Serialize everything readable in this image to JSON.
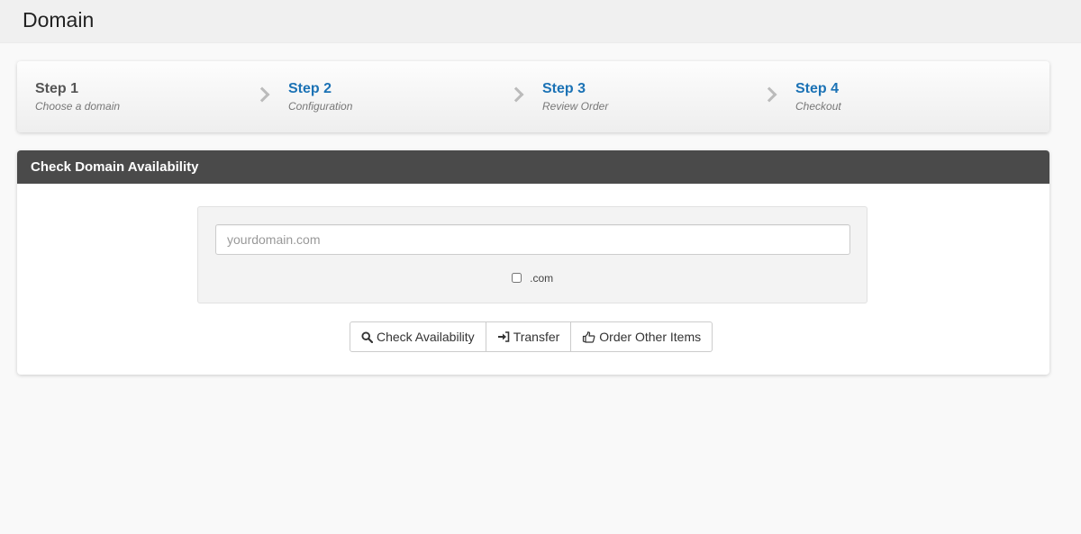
{
  "header": {
    "title": "Domain"
  },
  "steps": [
    {
      "title": "Step 1",
      "subtitle": "Choose a domain"
    },
    {
      "title": "Step 2",
      "subtitle": "Configuration"
    },
    {
      "title": "Step 3",
      "subtitle": "Review Order"
    },
    {
      "title": "Step 4",
      "subtitle": "Checkout"
    }
  ],
  "panel": {
    "heading": "Check Domain Availability",
    "domain_placeholder": "yourdomain.com",
    "domain_value": "",
    "tld_label": ".com",
    "tld_checked": false
  },
  "buttons": {
    "check": "Check Availability",
    "transfer": "Transfer",
    "order_other": "Order Other Items"
  },
  "icons": {
    "check": "search-icon",
    "transfer": "sign-in-icon",
    "order_other": "hand-pointing-icon",
    "step_separator": "chevron-right-icon"
  },
  "colors": {
    "step_link": "#1b72b5",
    "panel_heading_bg": "#4a4a4a"
  }
}
